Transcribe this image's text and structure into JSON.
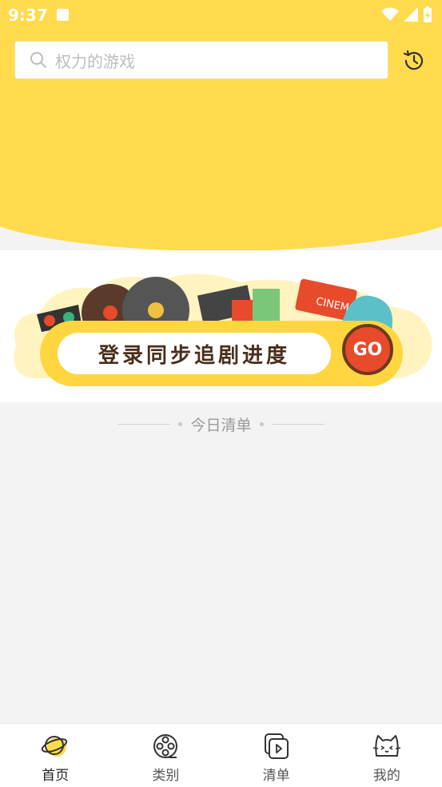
{
  "status_bar": {
    "time": "9:37"
  },
  "search": {
    "placeholder": "权力的游戏"
  },
  "banner": {
    "title": "登录同步追剧进度",
    "go_label": "GO",
    "cinema_label": "CINEMA"
  },
  "section": {
    "title": "今日清单"
  },
  "tabs": [
    {
      "label": "首页",
      "icon": "planet-icon",
      "active": true
    },
    {
      "label": "类别",
      "icon": "film-reel-icon",
      "active": false
    },
    {
      "label": "清单",
      "icon": "playlist-icon",
      "active": false
    },
    {
      "label": "我的",
      "icon": "cat-icon",
      "active": false
    }
  ],
  "colors": {
    "accent": "#ffdb4d",
    "background": "#f3f3f3",
    "go": "#e84a2c"
  }
}
